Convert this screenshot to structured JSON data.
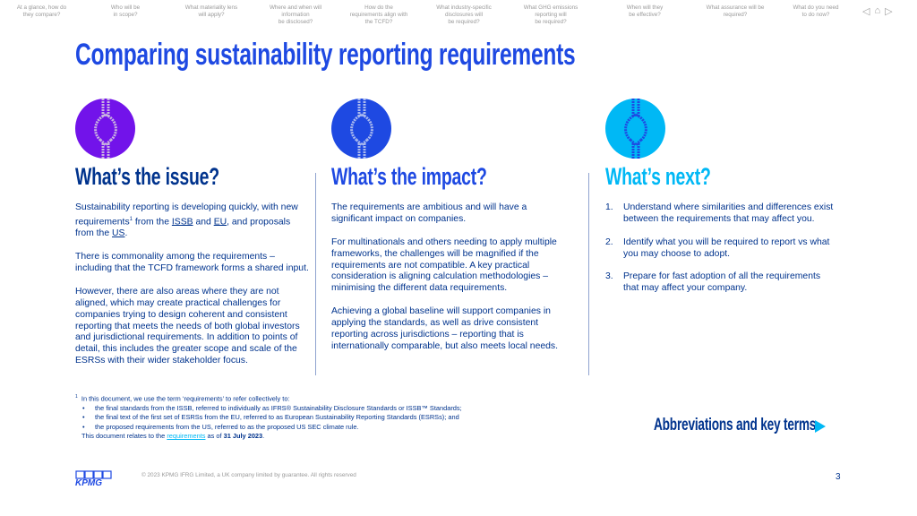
{
  "nav": [
    "At a glance, how do\nthey compare?",
    "Who will be\nin scope?",
    "What materiality lens\nwill apply?",
    "Where and when will\ninformation\nbe disclosed?",
    "How do the\nrequirements align with\nthe TCFD?",
    "What industry-specific\ndisclosures will\nbe required?",
    "What GHG emissions\nreporting will\nbe required?",
    "When will they\nbe effective?",
    "What assurance will be\nrequired?",
    "What do you need\nto do now?"
  ],
  "title": "Comparing sustainability reporting requirements",
  "colors": {
    "purple": "#7213EA",
    "blue": "#1E49E2",
    "light_blue": "#00B8F5",
    "dark_blue": "#00338D"
  },
  "issue": {
    "heading": "What’s the issue?",
    "p1": {
      "a": "Sustainability reporting is developing quickly, with new requirements",
      "sup": "1",
      "b": " from the ",
      "issb": "ISSB",
      "and": " and ",
      "eu": "EU",
      "c": ", and proposals from the ",
      "us": "US",
      "d": "."
    },
    "p2": "There is commonality among the requirements – including that the TCFD framework forms a shared input.",
    "p3": "However, there are also areas where they are not aligned, which may create practical challenges for companies trying to design coherent and consistent reporting that meets the needs of both global investors and jurisdictional requirements. In addition to points of detail, this includes the greater scope and scale of the ESRSs with their wider stakeholder focus."
  },
  "impact": {
    "heading": "What’s the impact?",
    "paragraphs": [
      "The requirements are ambitious and will have a significant impact on companies.",
      "For multinationals and others needing to apply multiple frameworks, the challenges will be magnified if the requirements are not compatible. A key practical consideration is aligning calculation methodologies – minimising the different data requirements.",
      "Achieving a global baseline will support companies in applying the standards, as well as drive consistent reporting across jurisdictions – reporting that is internationally comparable, but also meets local needs."
    ]
  },
  "next": {
    "heading": "What’s next?",
    "items": [
      {
        "n": "1.",
        "t": "Understand where similarities and differences exist between the requirements that may affect you."
      },
      {
        "n": "2.",
        "t": "Identify what you will be required to report vs what you may choose to adopt."
      },
      {
        "n": "3.",
        "t": "Prepare for fast adoption of all the requirements that may affect your company."
      }
    ]
  },
  "footnote": {
    "sup": "1",
    "intro": "In this document, we use the term ‘requirements’ to refer collectively to:",
    "bullets": [
      "the final standards from the ISSB, referred to individually as IFRS® Sustainability Disclosure Standards or ISSB™ Standards;",
      "the final text of the first set of ESRSs from the EU, referred to as European Sustainability Reporting Standards (ESRSs); and",
      "the proposed requirements from the US, referred to as the proposed US SEC climate rule."
    ],
    "relates_a": "This document relates to the ",
    "relates_link": "requirements",
    "relates_b": " as of ",
    "relates_date": "31 July 2023",
    "relates_c": "."
  },
  "abbreviations_link": "Abbreviations and key terms",
  "logo": "KPMG",
  "copyright": "© 2023 KPMG IFRG Limited, a UK company limited by guarantee.  All rights reserved",
  "page_number": "3"
}
